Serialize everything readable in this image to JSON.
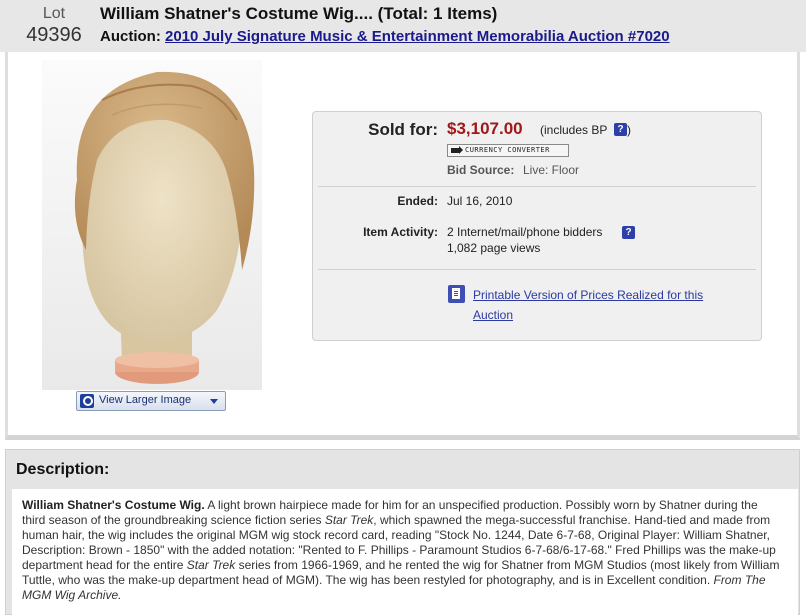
{
  "header": {
    "lot_word": "Lot",
    "lot_number": "49396",
    "title": "William Shatner's Costume Wig.... (Total: 1 Items)",
    "auction_label": "Auction:",
    "auction_link": "2010 July Signature Music & Entertainment Memorabilia Auction #7020"
  },
  "image": {
    "view_larger_label": "View Larger Image",
    "icons": [
      "magnifier-icon",
      "chevron-down-icon"
    ]
  },
  "sale": {
    "sold_label": "Sold for:",
    "price": "$3,107.00",
    "includes_bp": "(includes BP",
    "bp_close": ")",
    "help_glyph": "?",
    "currency_converter": "CURRENCY CONVERTER",
    "bid_source_label": "Bid Source:",
    "bid_source_value": "Live: Floor",
    "ended_label": "Ended:",
    "ended_value": "Jul 16, 2010",
    "activity_label": "Item Activity:",
    "bidders": "2 Internet/mail/phone bidders",
    "page_views": "1,082 page views",
    "printable_link": "Printable Version of Prices Realized for this Auction",
    "price_color": "#a01818"
  },
  "description": {
    "heading": "Description:",
    "lead": "William Shatner's Costume Wig.",
    "part1": " A light brown hairpiece made for him for an unspecified production. Possibly worn by Shatner during the third season of the groundbreaking science fiction series ",
    "title1": "Star Trek",
    "part2": ", which spawned the mega-successful franchise. Hand-tied and made from human hair, the wig includes the original MGM wig stock record card, reading \"Stock No. 1244, Date 6-7-68, Original Player: William Shatner, Description: Brown - 1850\" with the added notation: \"Rented to F. Phillips - Paramount Studios 6-7-68/6-17-68.\" Fred Phillips was the make-up department head for the entire ",
    "title2": "Star Trek",
    "part3": " series from 1966-1969, and he rented the wig for Shatner from MGM Studios (most likely from William Tuttle, who was the make-up department head of MGM). The wig has been restyled for photography, and is in Excellent condition. ",
    "source": "From The MGM Wig Archive."
  }
}
